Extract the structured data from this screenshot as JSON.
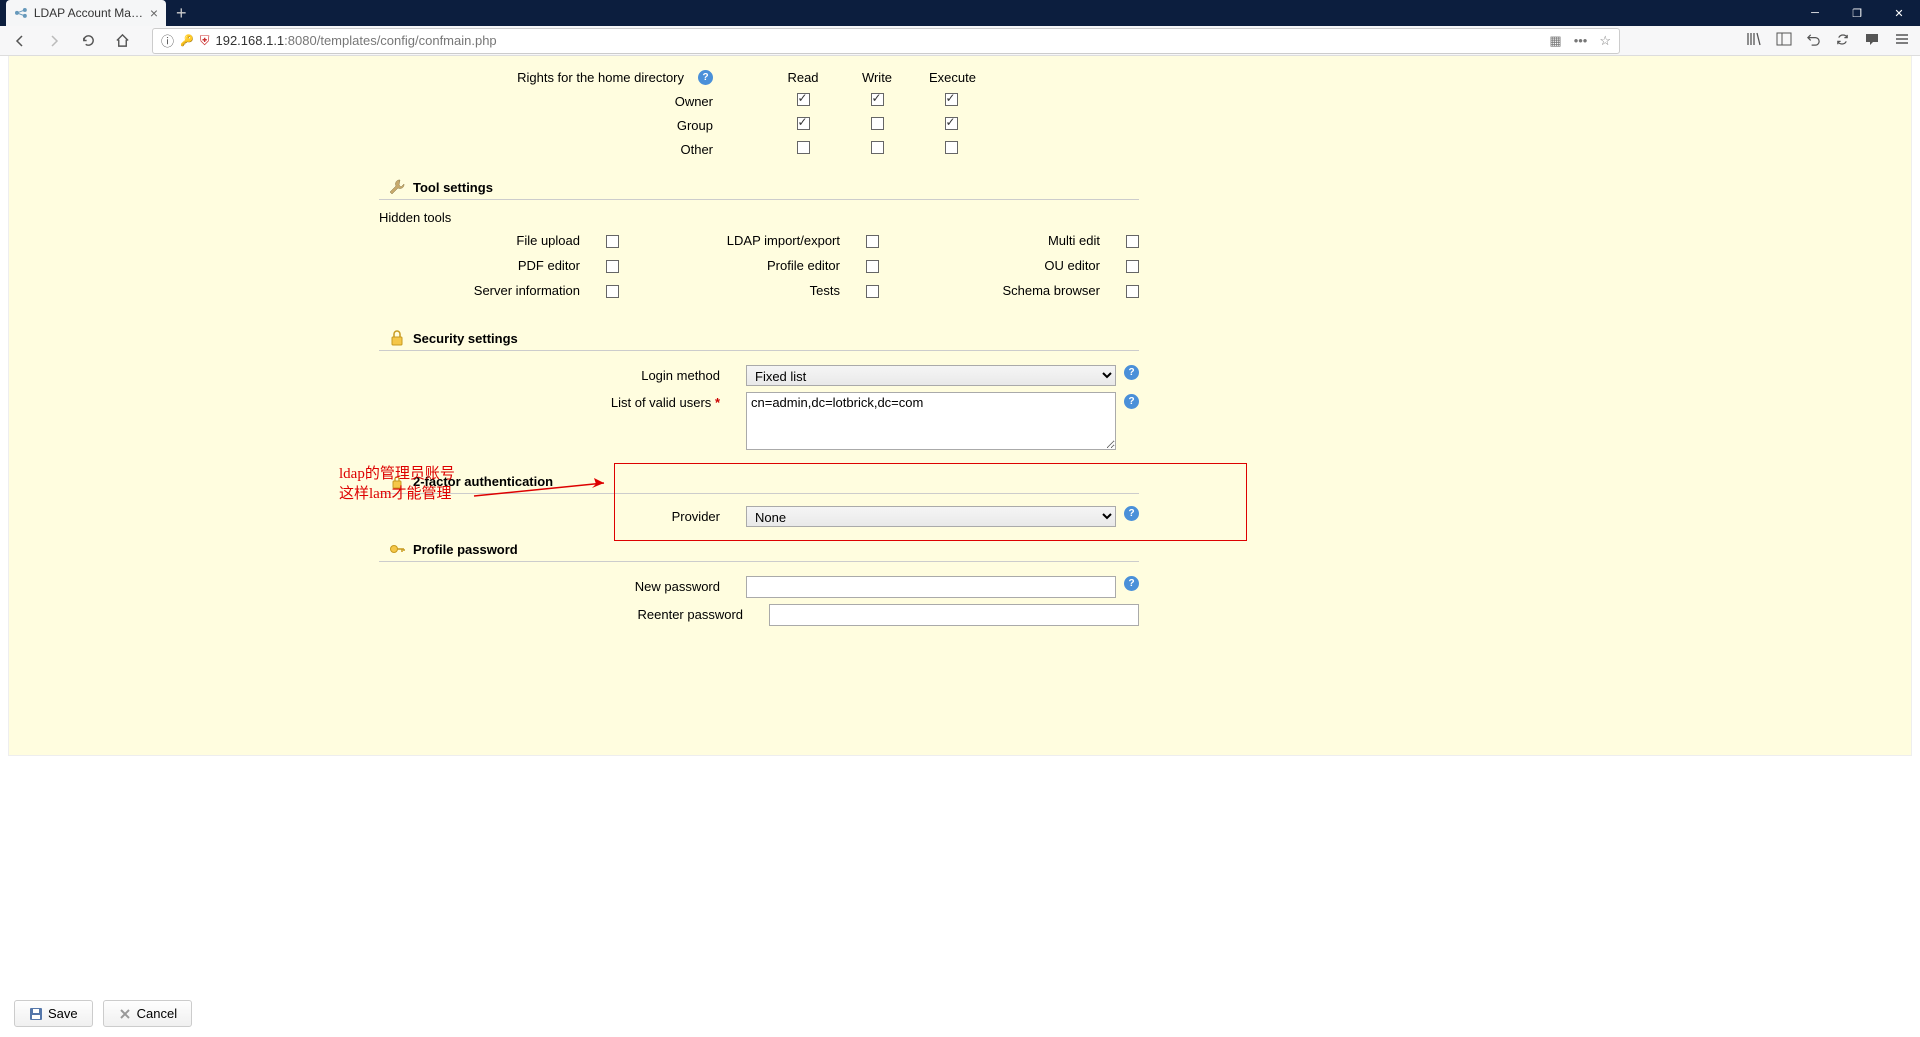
{
  "browser": {
    "tab_title": "LDAP Account Manager Con",
    "url_host": "192.168.1.1",
    "url_port": ":8080",
    "url_path": "/templates/config/confmain.php"
  },
  "rights": {
    "label": "Rights for the home directory",
    "columns": [
      "Read",
      "Write",
      "Execute"
    ],
    "rows": [
      {
        "name": "Owner",
        "vals": [
          true,
          true,
          true
        ]
      },
      {
        "name": "Group",
        "vals": [
          true,
          false,
          true
        ]
      },
      {
        "name": "Other",
        "vals": [
          false,
          false,
          false
        ]
      }
    ]
  },
  "sections": {
    "tool": "Tool settings",
    "security": "Security settings",
    "twofa": "2-factor authentication",
    "password": "Profile password"
  },
  "hidden_tools": {
    "label": "Hidden tools",
    "items": [
      {
        "label": "File upload",
        "checked": false
      },
      {
        "label": "LDAP import/export",
        "checked": false
      },
      {
        "label": "Multi edit",
        "checked": false
      },
      {
        "label": "PDF editor",
        "checked": false
      },
      {
        "label": "Profile editor",
        "checked": false
      },
      {
        "label": "OU editor",
        "checked": false
      },
      {
        "label": "Server information",
        "checked": false
      },
      {
        "label": "Tests",
        "checked": false
      },
      {
        "label": "Schema browser",
        "checked": false
      }
    ]
  },
  "security": {
    "login_method_label": "Login method",
    "login_method_value": "Fixed list",
    "valid_users_label": "List of valid users",
    "valid_users_value": "cn=admin,dc=lotbrick,dc=com"
  },
  "twofa": {
    "provider_label": "Provider",
    "provider_value": "None"
  },
  "password": {
    "new_label": "New password",
    "reenter_label": "Reenter password"
  },
  "annotation": {
    "line1": "ldap的管理员账号",
    "line2": "这样lam才能管理"
  },
  "buttons": {
    "save": "Save",
    "cancel": "Cancel"
  }
}
